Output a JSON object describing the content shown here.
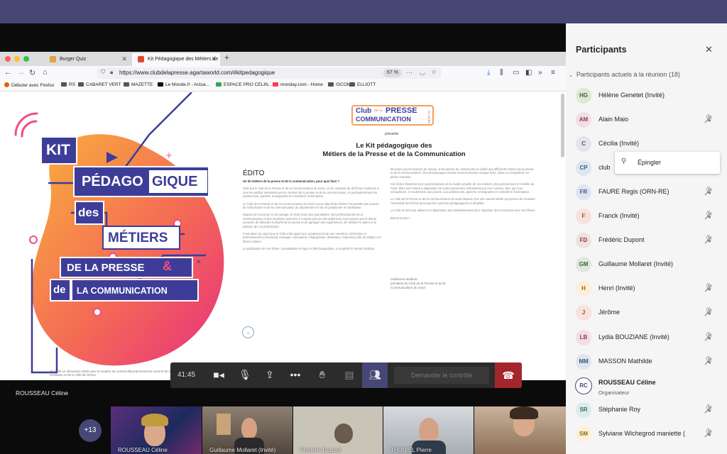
{
  "meeting": {
    "timer": "41:45",
    "request_control": "Demander le contrôle",
    "presenter_name": "ROUSSEAU Céline",
    "overflow_count": "+13"
  },
  "browser": {
    "tabs": [
      {
        "label": "Burger Quiz",
        "active": false
      },
      {
        "label": "Kit Pédagogique des Métiers de",
        "active": true
      }
    ],
    "url": "https://www.clubdelapresse.agartaworld.com/#kitpedagogique",
    "zoom": "67 %",
    "bookmarks": [
      "Débuter avec Firefox",
      "RS",
      "CABARET VERT",
      "MAZETTE",
      "Le Monde.fr - Actua...",
      "ESPACE PRO CELIN...",
      "monday.com - Home",
      "ISCOM",
      "ELLIOTT"
    ]
  },
  "kit_poster": {
    "line1": "KIT",
    "line2a": "PÉDAGO",
    "line2b": "GIQUE",
    "line3": "des",
    "line4": "MÉTIERS",
    "line5a": "DE LA PRESSE",
    "line5b": "&",
    "line6a": "de",
    "line6b": "LA COMMUNICATION",
    "caption": "Kit édité en décembre 2020 avec le soutien du conseil départemental du Gard et de la Région Occitanie et de la Ville de Nîmes"
  },
  "document": {
    "logo_club": "Club",
    "logo_press": "PRESSE",
    "logo_comm": "COMMUNICATION",
    "logo_small": "DE LA",
    "logo_gard": "DU GARD",
    "presente": "présente",
    "title_line1": "Le Kit pédagogique des",
    "title_line2": "Métiers de la Presse et de la Communication",
    "edito_heading": "ÉDITO",
    "intro_q": "Un kit métiers de la presse et de la communication, pour quoi faire ?",
    "left_paragraphs": [
      "Initié par le club de la Presse et de la Communication du Gard, ce kit composé de 30 fiches s'adresse à tous les publics intéressés par les métiers de la presse et de la communication, et particulièrement les adolescents, parents, enseignants et conseillers d'orientation.",
      "Le Club de la Presse et de la Communication du Gard a pour objectif de fédérer l'ensemble des acteurs de l'information et de la communication du département et de se positionner en facilitateur.",
      "Espace de rencontre et de partage, le Club réunit des journalistes, des professionnels de la communication et des membres associés. Il compte plus de 200 adhérents, tous acteurs par la même occasion de défendre la liberté de la presse et de partager des expériences, de célébrer le talent et la passion de ces professions.",
      "C'est dans cet esprit que le Club a fait appel aux compétences de ses membres, bénévoles et professionnels (community manager, concepteur, infographiste, illustrateur, rédacteur) afin de rédiger ces fiches métiers.",
      "La publication de ces fiches, consultables en ligne et téléchargeables, a complété le format d'édition."
    ],
    "right_paragraphs": [
      "Brochure par les acteurs du réseau, le kit permet de comprendre la réalité des différents métiers de la presse et de la communication. Des témoignages vivants viennent illustrer chaque fiche, dans un écosystème en pleine mutation.",
      "Ces fiches illustrées sont représentatives de la réalité actuelle de ces métiers, plus précisément à l'échelle du Gard. Elles sont mises à disposition de toutes personnes intéressées par leur contenu, bien que non exhaustives, et s'adressent aux jeunes, aux adolescents, parents, enseignants et conseillers d'orientation.",
      "Le Club de la Presse et de la Communication du Gard dispose d'un site internet dédié qui permet de consulter l'ensemble des fiches ainsi que les contenus pédagogiques et détaillés.",
      "Le Club se tient par ailleurs à la disposition des établissements pour organiser des rencontres avec les élèves."
    ],
    "closing": "Bonne lecture !",
    "signature_name": "Guillaume Mollaret,",
    "signature_role": "président du Club de la Presse et de la Communication du Gard"
  },
  "participants": {
    "title": "Participants",
    "section_label": "Participants actuels à la réunion (18)",
    "list": [
      {
        "initials": "HG",
        "name": "Hélène Genetet (Invité)",
        "muted": false,
        "color": "#dfe7d6",
        "text": "#4b5e37"
      },
      {
        "initials": "AM",
        "name": "Alain Maio",
        "muted": true,
        "color": "#f0dfe4",
        "text": "#8c3c55"
      },
      {
        "initials": "C",
        "name": "Cécilia (Invité)",
        "muted": false,
        "color": "#e3e5ea",
        "text": "#505768"
      },
      {
        "initials": "CP",
        "name": "club",
        "muted": false,
        "color": "#dde6f0",
        "text": "#3e5c81"
      },
      {
        "initials": "FR",
        "name": "FAURE Regis (ORN-RE)",
        "muted": true,
        "color": "#dde6f0",
        "text": "#3e5c81"
      },
      {
        "initials": "F",
        "name": "Franck (Invité)",
        "muted": true,
        "color": "#f7e1dc",
        "text": "#a9472f"
      },
      {
        "initials": "FD",
        "name": "Frédéric Dupont",
        "muted": true,
        "color": "#f2e0e0",
        "text": "#8a3a3a"
      },
      {
        "initials": "GM",
        "name": "Guillaume Mollaret (Invité)",
        "muted": false,
        "color": "#dfe9dc",
        "text": "#40633a"
      },
      {
        "initials": "H",
        "name": "Henri (Invité)",
        "muted": true,
        "color": "#fbeedb",
        "text": "#9a6411"
      },
      {
        "initials": "J",
        "name": "Jérôme",
        "muted": true,
        "color": "#f8e2dc",
        "text": "#a5452d"
      },
      {
        "initials": "LB",
        "name": "Lydia BOUZIANE (Invité)",
        "muted": true,
        "color": "#f1dfe6",
        "text": "#883a5b"
      },
      {
        "initials": "MM",
        "name": "MASSON Mathilde",
        "muted": true,
        "color": "#dee5ee",
        "text": "#3c5677"
      },
      {
        "initials": "RC",
        "name": "ROUSSEAU Céline",
        "role": "Organisateur",
        "muted": false,
        "color": "#ffffff",
        "text": "#464775"
      },
      {
        "initials": "SR",
        "name": "Stéphanie Roy",
        "muted": true,
        "color": "#dcecec",
        "text": "#2e6a6a"
      },
      {
        "initials": "SM",
        "name": "Sylviane Wichegrod maniette (",
        "muted": true,
        "color": "#fbf1d8",
        "text": "#8a6a12"
      }
    ],
    "context_menu_pin": "Épingler"
  },
  "video_tiles": [
    {
      "name": "ROUSSEAU Céline",
      "bg": "#3b2d5c"
    },
    {
      "name": "Guillaume Mollaret (Invité)",
      "bg": "#6a5a4c"
    },
    {
      "name": "Frédéric Dupont",
      "bg": "#b9b4a8"
    },
    {
      "name": "THONIEL Pierre",
      "bg": "#c2c7cc"
    },
    {
      "name": "",
      "bg": "#a88a6e"
    }
  ]
}
